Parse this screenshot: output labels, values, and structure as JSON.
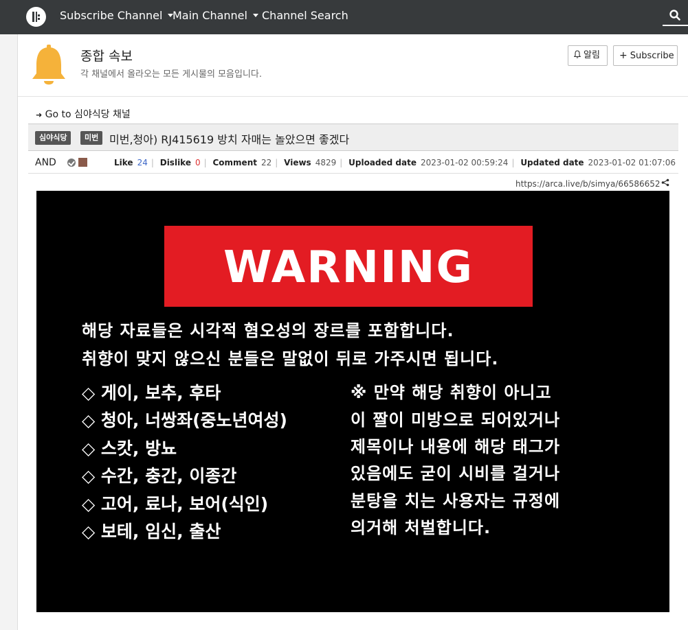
{
  "nav": {
    "logo": "channel-logo",
    "items": [
      {
        "label": "Subscribe Channel",
        "dropdown": true
      },
      {
        "label": "Main Channel",
        "dropdown": true
      },
      {
        "label": "Channel Search",
        "dropdown": false
      }
    ],
    "search_icon": "search-icon"
  },
  "board": {
    "title": "종합 속보",
    "description": "각 채널에서 올라오는 모든 게시물의 모음입니다.",
    "bell_button": "알림",
    "subscribe_button": "Subscribe",
    "icon": "bell-icon",
    "icon_color": "#f5b23a"
  },
  "goto": {
    "arrow": "➜",
    "label": "Go to 심야식당 채널"
  },
  "post": {
    "badges": [
      "심야식당",
      "미번"
    ],
    "title": "미번,청아) RJ415619 방치 자매는 놀았으면 좋겠다",
    "author": "AND",
    "stats": {
      "like_label": "Like",
      "like_value": "24",
      "dislike_label": "Dislike",
      "dislike_value": "0",
      "comment_label": "Comment",
      "comment_value": "22",
      "views_label": "Views",
      "views_value": "4829",
      "uploaded_label": "Uploaded date",
      "uploaded_value": "2023-01-02 00:59:24",
      "updated_label": "Updated date",
      "updated_value": "2023-01-02 01:07:06"
    },
    "url": "https://arca.live/b/simya/66586652"
  },
  "warning_image": {
    "heading": "WARNING",
    "intro": [
      "해당 자료들은 시각적 혐오성의 장르를 포함합니다.",
      "취향이 맞지 않으신 분들은 말없이 뒤로 가주시면 됩니다."
    ],
    "items": [
      "◇ 게이, 보추, 후타",
      "◇ 청아, 너쌍좌(중노년여성)",
      "◇ 스캇, 방뇨",
      "◇ 수간, 충간, 이종간",
      "◇ 고어, 료나, 보어(식인)",
      "◇ 보테, 임신, 출산"
    ],
    "note": [
      "※ 만약 해당 취향이 아니고",
      "이 짤이 미방으로 되어있거나",
      "제목이나 내용에 해당 태그가",
      "있음에도 굳이 시비를 걸거나",
      "분탕을 치는 사용자는 규정에",
      "의거해 처벌합니다."
    ],
    "colors": {
      "background": "#000000",
      "banner": "#e31c23",
      "text": "#ffffff"
    }
  }
}
